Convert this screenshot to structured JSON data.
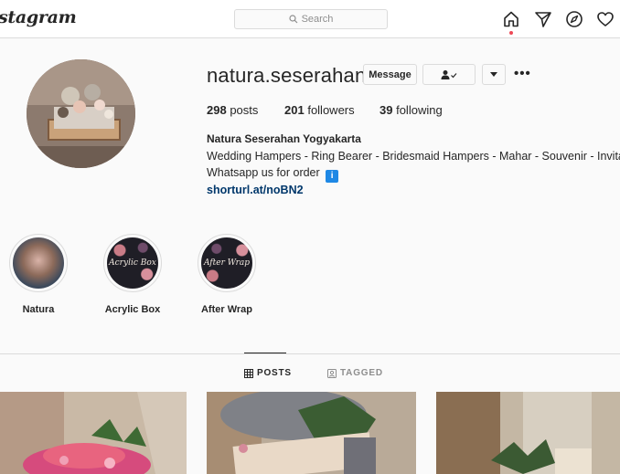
{
  "topbar": {
    "logo": "stagram",
    "search_placeholder": "Search"
  },
  "profile": {
    "username": "natura.seserahan",
    "message_label": "Message",
    "posts_count": "298",
    "posts_label": "posts",
    "followers_count": "201",
    "followers_label": "followers",
    "following_count": "39",
    "following_label": "following",
    "full_name": "Natura Seserahan Yogyakarta",
    "bio_line1": "Wedding Hampers - Ring Bearer - Bridesmaid Hampers - Mahar - Souvenir - Invita",
    "bio_line2": "Whatsapp us for order",
    "bio_badge": "i",
    "link": "shorturl.at/noBN2"
  },
  "highlights": [
    {
      "label": "Natura",
      "cover_text": ""
    },
    {
      "label": "Acrylic Box",
      "cover_text": "Acrylic Box"
    },
    {
      "label": "After Wrap",
      "cover_text": "After Wrap"
    }
  ],
  "tabs": {
    "posts": "POSTS",
    "tagged": "TAGGED"
  },
  "colors": {
    "accent_link": "#00376b",
    "notification_dot": "#ed4956",
    "info_badge": "#1e88e5"
  }
}
